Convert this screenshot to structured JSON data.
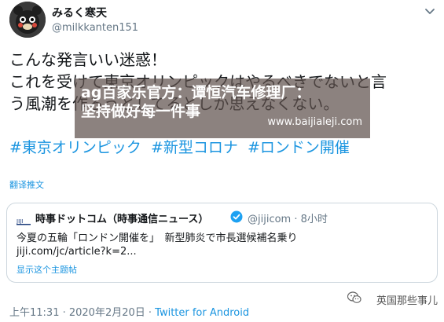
{
  "tweet": {
    "display_name": "みるく寒天",
    "handle": "@milkkanten151",
    "text_lines": [
      "こんな発言いい迷惑！",
      "これを受けて東京オリンピックはやるべきでないと言",
      "う風潮を作ろうとしてるとしか思えなくない。"
    ],
    "hashtags": [
      "#東京オリンピック",
      "#新型コロナ",
      "#ロンドン開催"
    ],
    "translate_label": "翻译推文",
    "timestamp": "上午11:31 · 2020年2月20日 · ",
    "client": "Twitter for Android"
  },
  "overlay": {
    "title_line1": "ag百家乐官方：谭恒汽车修理厂：",
    "title_line2": "坚持做好每一件事",
    "url": "www.baijialeji.com"
  },
  "quote": {
    "name": "時事ドットコム（時事通信ニュース）",
    "handle_time": "@jijicom · 8小时",
    "line1": "今夏の五輪「ロンドン開催を」　新型肺炎で市長選候補名乗り",
    "line2": "jiji.com/jc/article?k=2...",
    "show_thread": "显示这个主题帖"
  },
  "watermark": {
    "text": "英国那些事儿"
  },
  "colors": {
    "link": "#1b95e0",
    "secondary": "#657786",
    "overlay": "#5f524e"
  }
}
